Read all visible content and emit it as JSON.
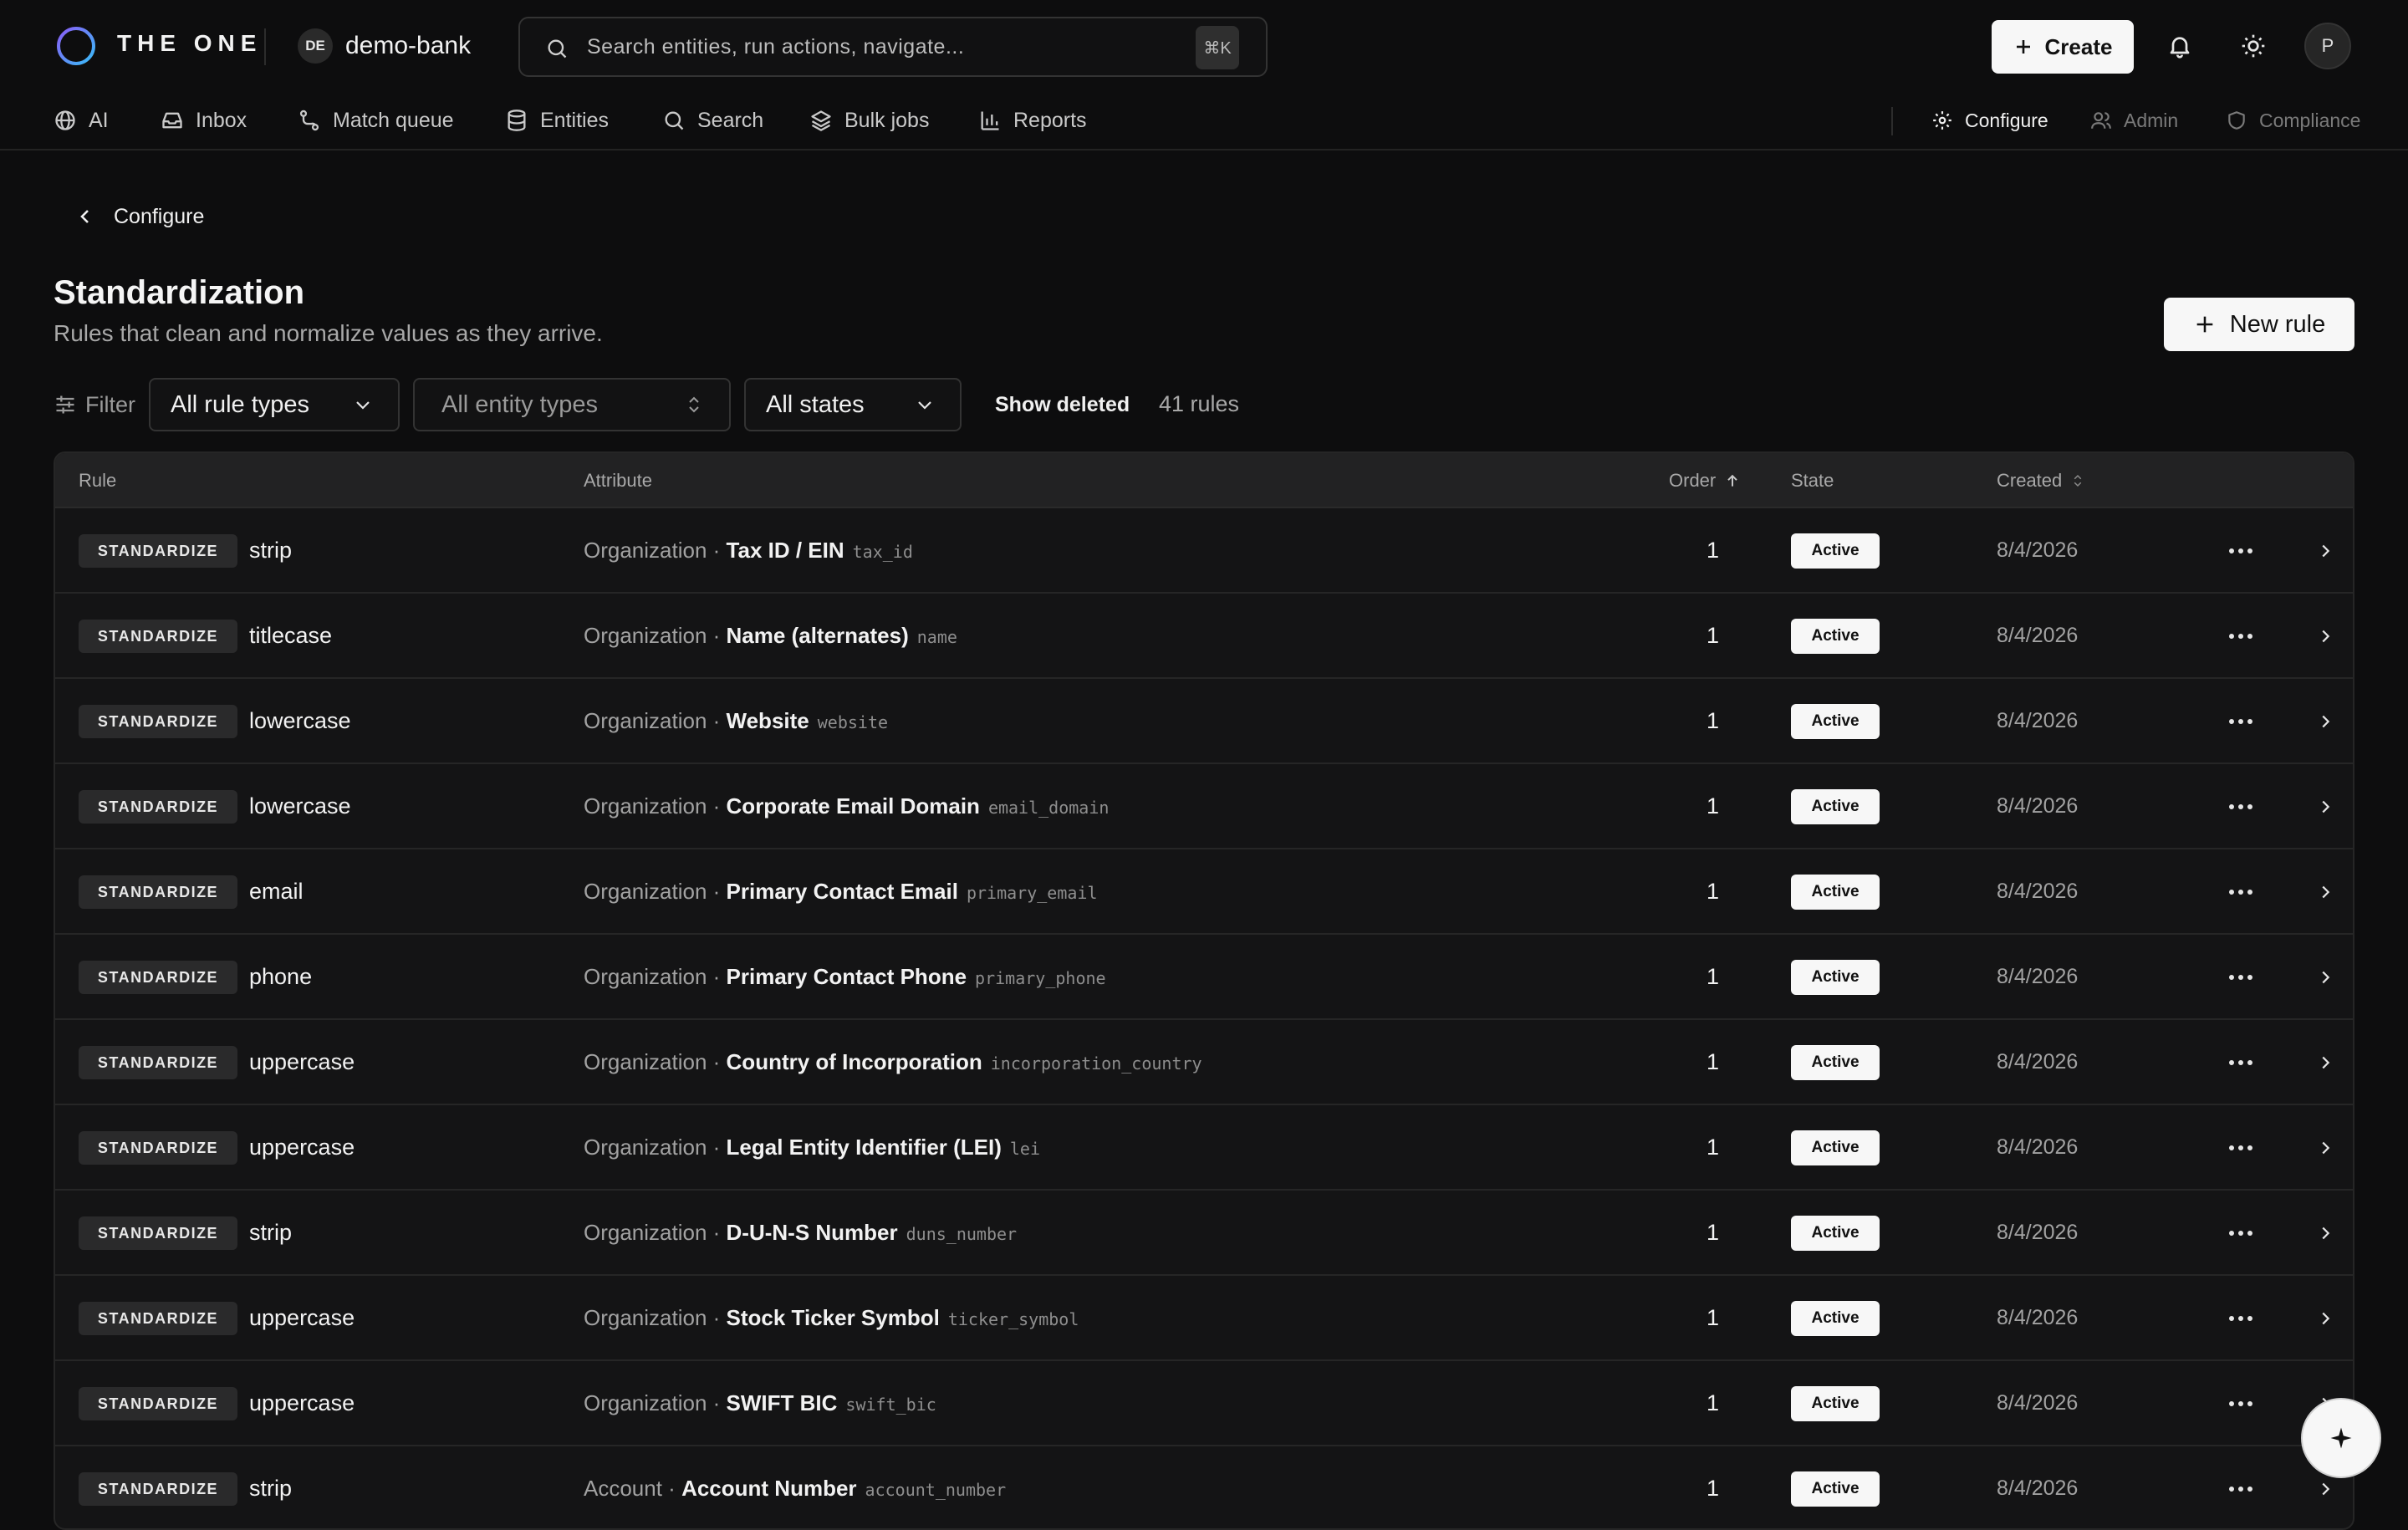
{
  "brand": {
    "name": "THE ONE",
    "workspace_badge": "DE",
    "workspace_name": "demo-bank"
  },
  "search": {
    "placeholder": "Search entities, run actions, navigate...",
    "shortcut": "⌘K",
    "icon": "search-icon"
  },
  "header": {
    "create_label": "Create",
    "avatar_initial": "P"
  },
  "nav": {
    "items": [
      {
        "label": "AI",
        "icon": "globe-icon"
      },
      {
        "label": "Inbox",
        "icon": "inbox-icon"
      },
      {
        "label": "Match queue",
        "icon": "route-icon"
      },
      {
        "label": "Entities",
        "icon": "database-icon"
      },
      {
        "label": "Search",
        "icon": "search-icon"
      },
      {
        "label": "Bulk jobs",
        "icon": "layers-icon"
      },
      {
        "label": "Reports",
        "icon": "bar-chart-icon"
      }
    ],
    "right": [
      {
        "label": "Configure",
        "icon": "gear-icon"
      },
      {
        "label": "Admin",
        "icon": "users-icon"
      },
      {
        "label": "Compliance",
        "icon": "shield-icon"
      }
    ]
  },
  "page": {
    "back_label": "Configure",
    "title": "Standardization",
    "subtitle": "Rules that clean and normalize values as they arrive.",
    "new_rule_label": "New rule"
  },
  "filters": {
    "label": "Filter",
    "rule_types": "All rule types",
    "entity_types": "All entity types",
    "states": "All states",
    "show_deleted": "Show deleted",
    "count": "41 rules"
  },
  "table": {
    "columns": {
      "rule": "Rule",
      "attribute": "Attribute",
      "order": "Order",
      "state": "State",
      "created": "Created"
    },
    "rows": [
      {
        "type": "STANDARDIZE",
        "rule": "strip",
        "entity": "Organization",
        "attr": "Tax ID / EIN",
        "key": "tax_id",
        "order": "1",
        "state": "Active",
        "created": "8/4/2026"
      },
      {
        "type": "STANDARDIZE",
        "rule": "titlecase",
        "entity": "Organization",
        "attr": "Name (alternates)",
        "key": "name",
        "order": "1",
        "state": "Active",
        "created": "8/4/2026"
      },
      {
        "type": "STANDARDIZE",
        "rule": "lowercase",
        "entity": "Organization",
        "attr": "Website",
        "key": "website",
        "order": "1",
        "state": "Active",
        "created": "8/4/2026"
      },
      {
        "type": "STANDARDIZE",
        "rule": "lowercase",
        "entity": "Organization",
        "attr": "Corporate Email Domain",
        "key": "email_domain",
        "order": "1",
        "state": "Active",
        "created": "8/4/2026"
      },
      {
        "type": "STANDARDIZE",
        "rule": "email",
        "entity": "Organization",
        "attr": "Primary Contact Email",
        "key": "primary_email",
        "order": "1",
        "state": "Active",
        "created": "8/4/2026"
      },
      {
        "type": "STANDARDIZE",
        "rule": "phone",
        "entity": "Organization",
        "attr": "Primary Contact Phone",
        "key": "primary_phone",
        "order": "1",
        "state": "Active",
        "created": "8/4/2026"
      },
      {
        "type": "STANDARDIZE",
        "rule": "uppercase",
        "entity": "Organization",
        "attr": "Country of Incorporation",
        "key": "incorporation_country",
        "order": "1",
        "state": "Active",
        "created": "8/4/2026"
      },
      {
        "type": "STANDARDIZE",
        "rule": "uppercase",
        "entity": "Organization",
        "attr": "Legal Entity Identifier (LEI)",
        "key": "lei",
        "order": "1",
        "state": "Active",
        "created": "8/4/2026"
      },
      {
        "type": "STANDARDIZE",
        "rule": "strip",
        "entity": "Organization",
        "attr": "D-U-N-S Number",
        "key": "duns_number",
        "order": "1",
        "state": "Active",
        "created": "8/4/2026"
      },
      {
        "type": "STANDARDIZE",
        "rule": "uppercase",
        "entity": "Organization",
        "attr": "Stock Ticker Symbol",
        "key": "ticker_symbol",
        "order": "1",
        "state": "Active",
        "created": "8/4/2026"
      },
      {
        "type": "STANDARDIZE",
        "rule": "uppercase",
        "entity": "Organization",
        "attr": "SWIFT BIC",
        "key": "swift_bic",
        "order": "1",
        "state": "Active",
        "created": "8/4/2026"
      },
      {
        "type": "STANDARDIZE",
        "rule": "strip",
        "entity": "Account",
        "attr": "Account Number",
        "key": "account_number",
        "order": "1",
        "state": "Active",
        "created": "8/4/2026"
      }
    ]
  },
  "fab": {
    "icon": "sparkle-icon"
  }
}
